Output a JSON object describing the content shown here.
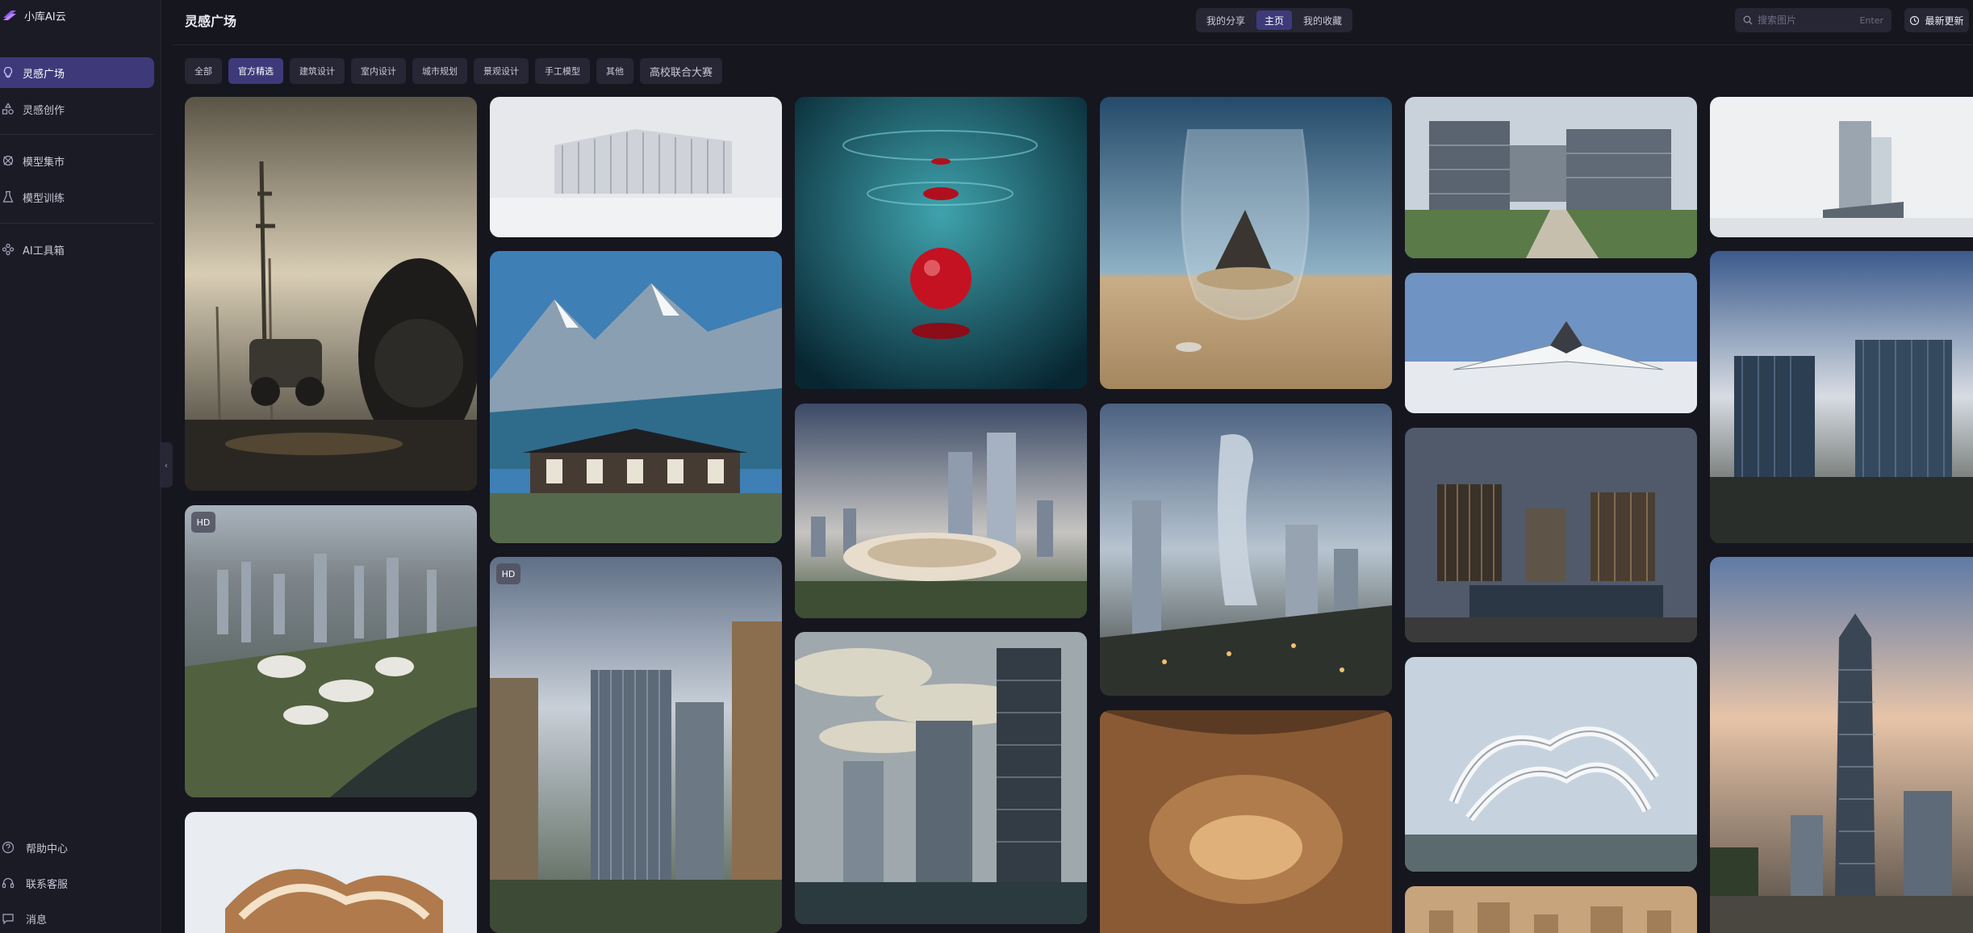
{
  "brand": {
    "name": "小库AI云"
  },
  "nav": {
    "items": [
      {
        "label": "灵感广场",
        "icon": "lightbulb-icon",
        "active": true
      },
      {
        "label": "灵感创作",
        "icon": "shapes-icon",
        "active": false
      },
      {
        "label": "模型集市",
        "icon": "model-market-icon",
        "active": false
      },
      {
        "label": "模型训练",
        "icon": "flask-icon",
        "active": false
      },
      {
        "label": "AI工具箱",
        "icon": "toolbox-icon",
        "active": false
      }
    ],
    "bottom": [
      {
        "label": "帮助中心",
        "icon": "help-circle-icon"
      },
      {
        "label": "联系客服",
        "icon": "headset-icon"
      },
      {
        "label": "消息",
        "icon": "message-icon"
      }
    ]
  },
  "header": {
    "title": "灵感广场",
    "view_options": [
      "我的分享",
      "主页",
      "我的收藏"
    ],
    "active_view": "主页",
    "search": {
      "placeholder": "搜索图片",
      "hint": "Enter"
    },
    "update_button": "最新更新"
  },
  "categories": [
    "全部",
    "官方精选",
    "建筑设计",
    "室内设计",
    "城市规划",
    "景观设计",
    "手工模型",
    "其他",
    "高校联合大赛"
  ],
  "active_category": "官方精选",
  "gallery": {
    "badge_label": "HD",
    "columns": [
      [
        {
          "subject": "Tractor and power towers in misty landscape",
          "hd": false
        },
        {
          "subject": "Aerial city masterplan with white pavilions by river",
          "hd": true
        },
        {
          "subject": "Curved wooden organic building",
          "hd": false
        }
      ],
      [
        {
          "subject": "White ribbed pavilion on snow",
          "hd": false
        },
        {
          "subject": "Traditional roof building under snowy mountains",
          "hd": false
        },
        {
          "subject": "Glass office towers in courtyard",
          "hd": true
        }
      ],
      [
        {
          "subject": "Red droplet on teal water",
          "hd": false
        },
        {
          "subject": "Twin glass towers with curved podium at dusk",
          "hd": false
        },
        {
          "subject": "Waterfront glass towers under dramatic sky",
          "hd": false
        }
      ],
      [
        {
          "subject": "Glass vase holding island on sand",
          "hd": false
        },
        {
          "subject": "Twisting glass skyscrapers over city",
          "hd": false
        },
        {
          "subject": "Sandstone canyon interior",
          "hd": false
        }
      ],
      [
        {
          "subject": "Glass campus building with landscaped plaza",
          "hd": false
        },
        {
          "subject": "Winged white building on snow",
          "hd": false
        },
        {
          "subject": "Dark glass buildings beside reflecting pool",
          "hd": false
        },
        {
          "subject": "Swirling white parametric pavilion",
          "hd": false
        },
        {
          "subject": "Wooden architectural model",
          "hd": false
        }
      ],
      [
        {
          "subject": "Glass tower in foggy white landscape",
          "hd": false
        },
        {
          "subject": "Glass office blocks under dramatic clouds",
          "hd": false
        },
        {
          "subject": "Tall glass skyscraper at sunset",
          "hd": false
        }
      ]
    ]
  }
}
